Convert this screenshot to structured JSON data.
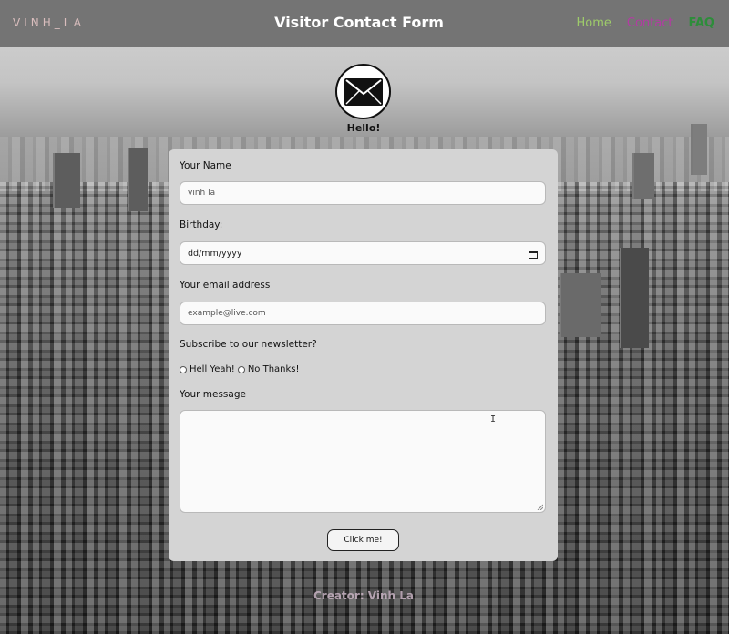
{
  "header": {
    "logo": "VINH_LA",
    "title": "Visitor Contact Form",
    "nav": {
      "home": "Home",
      "contact": "Contact",
      "faq": "FAQ"
    }
  },
  "hero": {
    "greeting": "Hello!",
    "icon": "envelope-icon"
  },
  "form": {
    "name_label": "Your Name",
    "name_placeholder": "vinh la",
    "birthday_label": "Birthday:",
    "birthday_value": "dd/mm/yyyy",
    "email_label": "Your email address",
    "email_placeholder": "example@live.com",
    "newsletter_label": "Subscribe to our newsletter?",
    "newsletter_options": [
      "Hell Yeah!",
      "No Thanks!"
    ],
    "message_label": "Your message",
    "submit_label": "Click me!"
  },
  "footer": {
    "credit": "Creator: Vinh La"
  },
  "colors": {
    "header_bg": "#747474",
    "nav_home": "#9ecb6a",
    "nav_contact": "#b23ca2",
    "nav_faq": "#2d8d3a",
    "card_bg": "#d4d4d4"
  }
}
